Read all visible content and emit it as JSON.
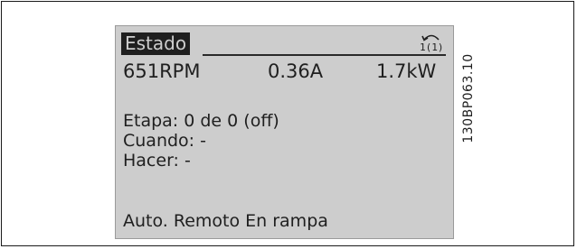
{
  "display": {
    "title": "Estado",
    "setup_indicator": "1(1)",
    "readouts": {
      "speed": "651RPM",
      "current": "0.36A",
      "power": "1.7kW"
    },
    "lines": [
      "Etapa: 0 de 0 (off)",
      "Cuando: -",
      "Hacer: -"
    ],
    "status_line": "Auto. Remoto En rampa"
  },
  "figure": {
    "code": "130BP063.10"
  }
}
